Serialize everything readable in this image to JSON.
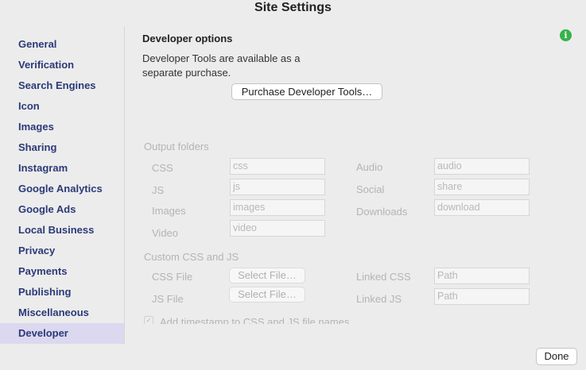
{
  "window": {
    "title": "Site Settings"
  },
  "sidebar": {
    "items": [
      {
        "label": "General"
      },
      {
        "label": "Verification"
      },
      {
        "label": "Search Engines"
      },
      {
        "label": "Icon"
      },
      {
        "label": "Images"
      },
      {
        "label": "Sharing"
      },
      {
        "label": "Instagram"
      },
      {
        "label": "Google Analytics"
      },
      {
        "label": "Google Ads"
      },
      {
        "label": "Local Business"
      },
      {
        "label": "Privacy"
      },
      {
        "label": "Payments"
      },
      {
        "label": "Publishing"
      },
      {
        "label": "Miscellaneous"
      },
      {
        "label": "Developer",
        "selected": true
      }
    ]
  },
  "developer": {
    "heading": "Developer options",
    "description": "Developer Tools are available as a separate purchase.",
    "purchase_label": "Purchase Developer Tools…",
    "info_icon": "i"
  },
  "output_folders": {
    "label": "Output folders",
    "css": {
      "label": "CSS",
      "value": "css"
    },
    "js": {
      "label": "JS",
      "value": "js"
    },
    "images": {
      "label": "Images",
      "value": "images"
    },
    "video": {
      "label": "Video",
      "value": "video"
    },
    "audio": {
      "label": "Audio",
      "value": "audio"
    },
    "social": {
      "label": "Social",
      "value": "share"
    },
    "downloads": {
      "label": "Downloads",
      "value": "download"
    }
  },
  "custom": {
    "label": "Custom CSS and JS",
    "css_file_label": "CSS File",
    "js_file_label": "JS File",
    "select_file_label": "Select File…",
    "linked_css_label": "Linked CSS",
    "linked_js_label": "Linked JS",
    "path_placeholder": "Path",
    "timestamp_label": "Add timestamp to CSS and JS file names"
  },
  "footer": {
    "done_label": "Done"
  },
  "colors": {
    "selected_bg": "#dcd8f0",
    "link": "#2b3a78",
    "info": "#36b24a"
  }
}
